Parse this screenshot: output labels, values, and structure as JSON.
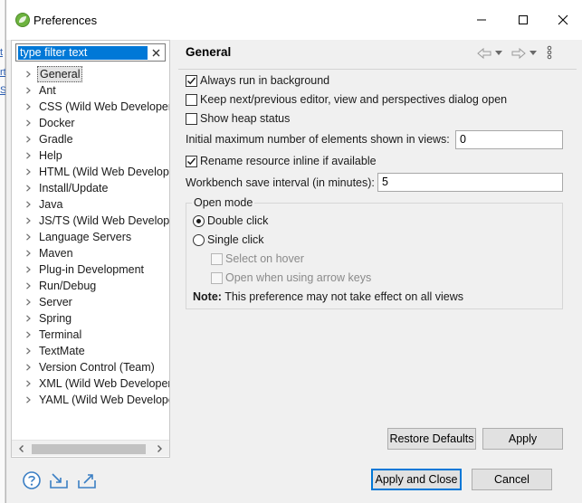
{
  "window": {
    "title": "Preferences"
  },
  "colors": {
    "accent": "#0078d7",
    "icon_blue": "#3b7fc4",
    "spring_green": "#6db33f"
  },
  "filter": {
    "value": "type filter text",
    "placeholder": "type filter text"
  },
  "tree": [
    {
      "label": "General",
      "selected": true
    },
    {
      "label": "Ant"
    },
    {
      "label": "CSS (Wild Web Developer)"
    },
    {
      "label": "Docker"
    },
    {
      "label": "Gradle"
    },
    {
      "label": "Help"
    },
    {
      "label": "HTML (Wild Web Developer)"
    },
    {
      "label": "Install/Update"
    },
    {
      "label": "Java"
    },
    {
      "label": "JS/TS (Wild Web Developer)"
    },
    {
      "label": "Language Servers"
    },
    {
      "label": "Maven"
    },
    {
      "label": "Plug-in Development"
    },
    {
      "label": "Run/Debug"
    },
    {
      "label": "Server"
    },
    {
      "label": "Spring"
    },
    {
      "label": "Terminal"
    },
    {
      "label": "TextMate"
    },
    {
      "label": "Version Control (Team)"
    },
    {
      "label": "XML (Wild Web Developer)"
    },
    {
      "label": "YAML (Wild Web Developer)"
    }
  ],
  "page": {
    "title": "General",
    "options": {
      "always_run_bg": {
        "label": "Always run in background",
        "checked": true
      },
      "keep_next_prev": {
        "label": "Keep next/previous editor, view and perspectives dialog open",
        "checked": false
      },
      "show_heap": {
        "label": "Show heap status",
        "checked": false
      },
      "rename_inline": {
        "label": "Rename resource inline if available",
        "checked": true
      }
    },
    "max_elements": {
      "label": "Initial maximum number of elements shown in views:",
      "value": "0"
    },
    "save_interval": {
      "label": "Workbench save interval (in minutes):",
      "value": "5"
    },
    "open_mode": {
      "title": "Open mode",
      "double_click": "Double click",
      "single_click": "Single click",
      "selected": "double_click",
      "select_on_hover": "Select on hover",
      "open_arrow_keys": "Open when using arrow keys",
      "note_label": "Note:",
      "note_text": " This preference may not take effect on all views"
    },
    "restore_defaults": "Restore Defaults",
    "apply": "Apply"
  },
  "footer": {
    "apply_close": "Apply and Close",
    "cancel": "Cancel"
  }
}
